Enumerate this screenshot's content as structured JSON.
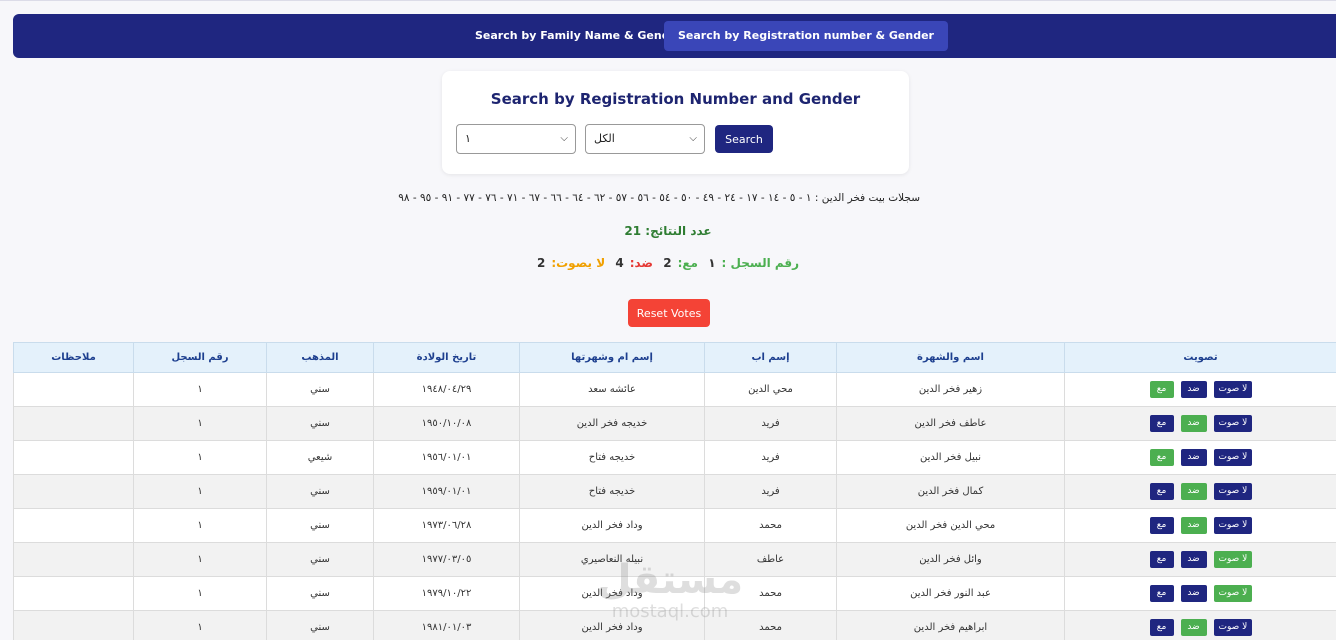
{
  "nav": {
    "family_tab": "Search by Family Name & Gender",
    "registration_tab": "Search by Registration number & Gender"
  },
  "search": {
    "title": "Search by Registration Number and Gender",
    "registration_value": "١",
    "gender_value": "الكل",
    "button": "Search"
  },
  "records_line": "سجلات بيت فخر الدين : ١ - ٥ - ١٤ - ١٧ - ٢٤ - ٤٩ - ٥٠ - ٥٤ - ٥٦ - ٥٧ - ٦٢ - ٦٤ - ٦٦ - ٦٧ - ٧١ - ٧٦ - ٧٧ - ٩١ - ٩٥ - ٩٨",
  "results": {
    "label": "عدد النتائج:",
    "count": "21"
  },
  "summary": {
    "record_label": "رقم السجل :",
    "record_value": "١",
    "for_label": "مع:",
    "for_value": "2",
    "against_label": "ضد:",
    "against_value": "4",
    "no_vote_label": "لا يصوت:",
    "no_vote_value": "2"
  },
  "reset_button": "Reset Votes",
  "vote_labels": {
    "for": "مع",
    "against": "ضد",
    "no_vote": "لا صوت"
  },
  "colors": {
    "navy": "#1f2680",
    "green": "#4caf50",
    "red": "#f44336",
    "orange": "#f0a000"
  },
  "table": {
    "headers": {
      "vote": "تصويت",
      "name": "اسم والشهرة",
      "father": "إسم اب",
      "mother": "إسم ام وشهرتها",
      "birth": "تاريخ الولادة",
      "sect": "المذهب",
      "reg": "رقم السجل",
      "notes": "ملاحظات"
    },
    "rows": [
      {
        "name": "زهير فخر الدين",
        "father": "محي الدين",
        "mother": "عائشه سعد",
        "birth": "١٩٤٨/٠٤/٢٩",
        "sect": "سني",
        "reg": "١",
        "notes": "",
        "selected": "for"
      },
      {
        "name": "عاطف فخر الدين",
        "father": "فريد",
        "mother": "خديجه فخر الدين",
        "birth": "١٩٥٠/١٠/٠٨",
        "sect": "سني",
        "reg": "١",
        "notes": "",
        "selected": "against"
      },
      {
        "name": "نبيل فخر الدين",
        "father": "فريد",
        "mother": "خديجه فتاح",
        "birth": "١٩٥٦/٠١/٠١",
        "sect": "شيعي",
        "reg": "١",
        "notes": "",
        "selected": "for"
      },
      {
        "name": "كمال فخر الدين",
        "father": "فريد",
        "mother": "خديجه فتاح",
        "birth": "١٩٥٩/٠١/٠١",
        "sect": "سني",
        "reg": "١",
        "notes": "",
        "selected": "against"
      },
      {
        "name": "محي الدين فخر الدين",
        "father": "محمد",
        "mother": "وداد فخر الدين",
        "birth": "١٩٧٣/٠٦/٢٨",
        "sect": "سني",
        "reg": "١",
        "notes": "",
        "selected": "against"
      },
      {
        "name": "وائل فخر الدين",
        "father": "عاطف",
        "mother": "نبيله النعاصيري",
        "birth": "١٩٧٧/٠٣/٠٥",
        "sect": "سني",
        "reg": "١",
        "notes": "",
        "selected": "no_vote"
      },
      {
        "name": "عبد النور فخر الدين",
        "father": "محمد",
        "mother": "وداد فخر الدين",
        "birth": "١٩٧٩/١٠/٢٢",
        "sect": "سني",
        "reg": "١",
        "notes": "",
        "selected": "no_vote"
      },
      {
        "name": "ابراهيم فخر الدين",
        "father": "محمد",
        "mother": "وداد فخر الدين",
        "birth": "١٩٨١/٠١/٠٣",
        "sect": "سني",
        "reg": "١",
        "notes": "",
        "selected": "against"
      }
    ]
  },
  "watermark": {
    "arabic": "مستقل",
    "latin": "mostaql.com"
  }
}
